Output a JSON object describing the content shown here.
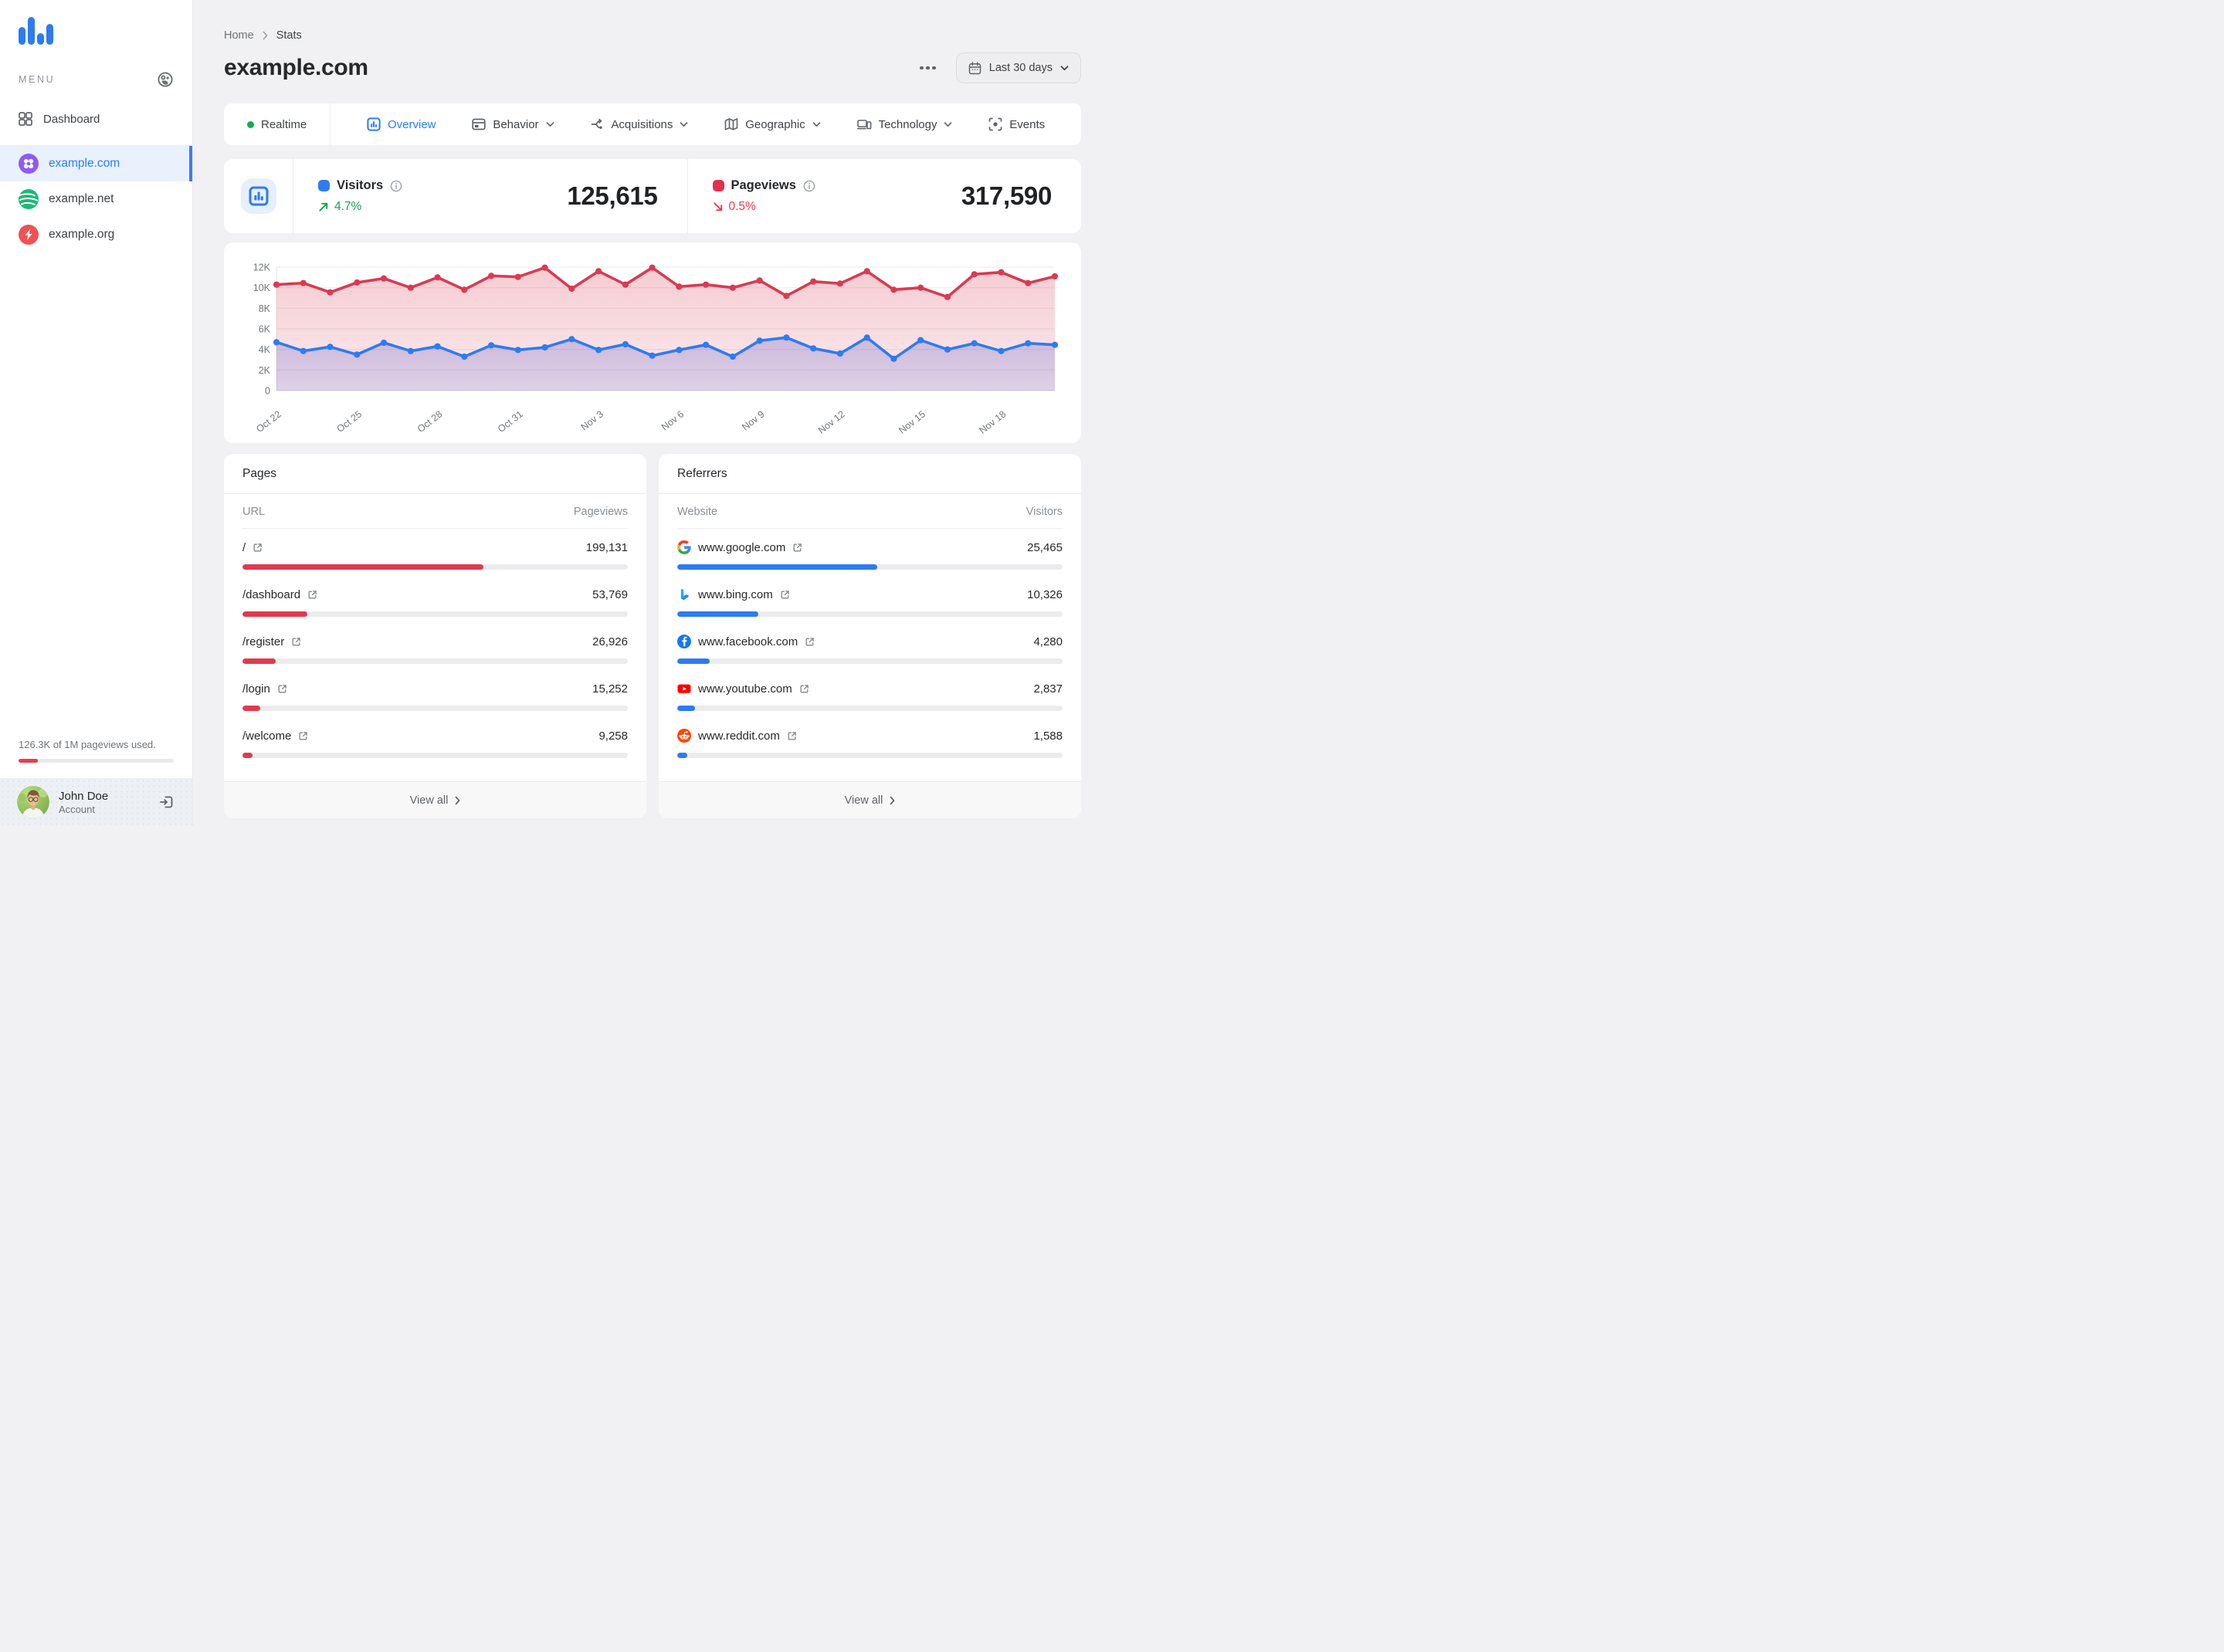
{
  "colors": {
    "accent_blue": "#2e7bf0",
    "accent_red": "#d83b52",
    "positive_green": "#17a34a",
    "negative_red": "#e23d55",
    "active_item_bg": "#e9f1fd"
  },
  "sidebar": {
    "menu_label": "MENU",
    "dashboard_label": "Dashboard",
    "sites": [
      {
        "name": "example.com",
        "active": true
      },
      {
        "name": "example.net",
        "active": false
      },
      {
        "name": "example.org",
        "active": false
      }
    ],
    "usage_text": "126.3K of 1M pageviews used.",
    "usage_percent": 12.6,
    "user_name": "John Doe",
    "user_role": "Account"
  },
  "header": {
    "breadcrumb": {
      "0": "Home",
      "1": "Stats"
    },
    "title": "example.com",
    "date_range_label": "Last 30 days"
  },
  "tabs": [
    {
      "label": "Realtime"
    },
    {
      "label": "Overview",
      "active": true
    },
    {
      "label": "Behavior",
      "dropdown": true
    },
    {
      "label": "Acquisitions",
      "dropdown": true
    },
    {
      "label": "Geographic",
      "dropdown": true
    },
    {
      "label": "Technology",
      "dropdown": true
    },
    {
      "label": "Events"
    }
  ],
  "stats": {
    "visitors": {
      "label": "Visitors",
      "delta": "4.7%",
      "direction": "up",
      "value": "125,615"
    },
    "pageviews": {
      "label": "Pageviews",
      "delta": "0.5%",
      "direction": "down",
      "value": "317,590"
    }
  },
  "chart_data": {
    "type": "area",
    "title": "Visitors and pageviews over last 30 days",
    "x": [
      "Oct 22",
      "Oct 23",
      "Oct 24",
      "Oct 25",
      "Oct 26",
      "Oct 27",
      "Oct 28",
      "Oct 29",
      "Oct 30",
      "Oct 31",
      "Nov 1",
      "Nov 2",
      "Nov 3",
      "Nov 4",
      "Nov 5",
      "Nov 6",
      "Nov 7",
      "Nov 8",
      "Nov 9",
      "Nov 10",
      "Nov 11",
      "Nov 12",
      "Nov 13",
      "Nov 14",
      "Nov 15",
      "Nov 16",
      "Nov 17",
      "Nov 18",
      "Nov 19",
      "Nov 20"
    ],
    "x_tick_every": 3,
    "y_ticks": [
      "0",
      "2K",
      "4K",
      "6K",
      "8K",
      "10K",
      "12K"
    ],
    "ylim": [
      0,
      12000
    ],
    "grid": true,
    "legend": "none",
    "series": [
      {
        "name": "Visitors",
        "color": "#2e7bf0",
        "values": [
          4700,
          3850,
          4250,
          3500,
          4650,
          3850,
          4300,
          3300,
          4400,
          3950,
          4200,
          5000,
          3950,
          4500,
          3400,
          3950,
          4450,
          3300,
          4850,
          5150,
          4100,
          3600,
          5150,
          3100,
          4900,
          4000,
          4600,
          3850,
          4600,
          4450
        ]
      },
      {
        "name": "Pageviews",
        "color": "#d83b52",
        "values": [
          10300,
          10450,
          9550,
          10500,
          10900,
          10000,
          11000,
          9800,
          11150,
          11050,
          11950,
          9900,
          11600,
          10300,
          11950,
          10100,
          10300,
          10000,
          10700,
          9200,
          10600,
          10400,
          11600,
          9800,
          10000,
          9100,
          11300,
          11500,
          10450,
          11100
        ]
      }
    ]
  },
  "pages_panel": {
    "title": "Pages",
    "col_name": "URL",
    "col_value": "Pageviews",
    "view_all": "View all",
    "rows": [
      {
        "url": "/",
        "value": "199,131",
        "bar_percent": 62.5
      },
      {
        "url": "/dashboard",
        "value": "53,769",
        "bar_percent": 16.9
      },
      {
        "url": "/register",
        "value": "26,926",
        "bar_percent": 8.6
      },
      {
        "url": "/login",
        "value": "15,252",
        "bar_percent": 4.6
      },
      {
        "url": "/welcome",
        "value": "9,258",
        "bar_percent": 2.7
      }
    ]
  },
  "referrers_panel": {
    "title": "Referrers",
    "col_name": "Website",
    "col_value": "Visitors",
    "view_all": "View all",
    "rows": [
      {
        "site": "www.google.com",
        "value": "25,465",
        "bar_percent": 52,
        "icon": "google-favicon"
      },
      {
        "site": "www.bing.com",
        "value": "10,326",
        "bar_percent": 21,
        "icon": "bing-favicon"
      },
      {
        "site": "www.facebook.com",
        "value": "4,280",
        "bar_percent": 8.4,
        "icon": "facebook-favicon"
      },
      {
        "site": "www.youtube.com",
        "value": "2,837",
        "bar_percent": 4.7,
        "icon": "youtube-favicon"
      },
      {
        "site": "www.reddit.com",
        "value": "1,588",
        "bar_percent": 2.6,
        "icon": "reddit-favicon"
      }
    ]
  }
}
